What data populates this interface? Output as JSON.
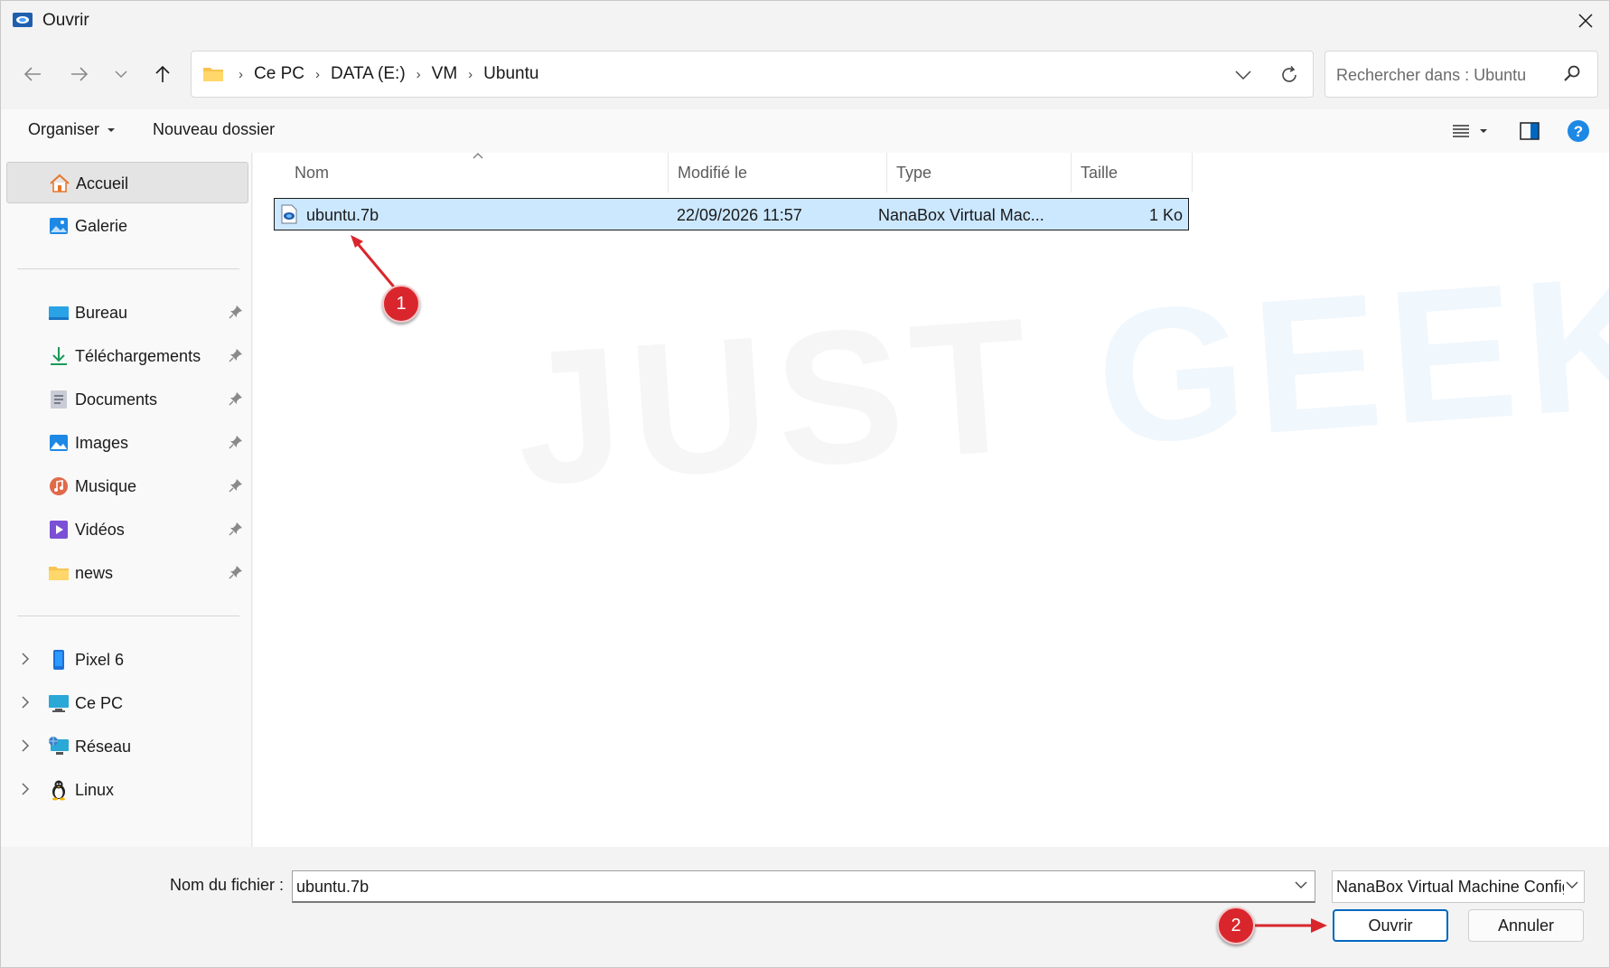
{
  "window": {
    "title": "Ouvrir"
  },
  "address": {
    "crumbs": [
      "Ce PC",
      "DATA (E:)",
      "VM",
      "Ubuntu"
    ]
  },
  "search": {
    "placeholder": "Rechercher dans : Ubuntu"
  },
  "toolbar": {
    "organize_label": "Organiser",
    "new_folder_label": "Nouveau dossier"
  },
  "sidebar": {
    "top_items": [
      {
        "label": "Accueil",
        "icon": "home-icon",
        "selected": true
      },
      {
        "label": "Galerie",
        "icon": "gallery-icon"
      }
    ],
    "pinned_items": [
      {
        "label": "Bureau",
        "icon": "desktop-icon"
      },
      {
        "label": "Téléchargements",
        "icon": "download-icon"
      },
      {
        "label": "Documents",
        "icon": "documents-icon"
      },
      {
        "label": "Images",
        "icon": "pictures-icon"
      },
      {
        "label": "Musique",
        "icon": "music-icon"
      },
      {
        "label": "Vidéos",
        "icon": "videos-icon"
      },
      {
        "label": "news",
        "icon": "folder-icon"
      }
    ],
    "device_items": [
      {
        "label": "Pixel 6",
        "icon": "phone-icon"
      },
      {
        "label": "Ce PC",
        "icon": "computer-icon"
      },
      {
        "label": "Réseau",
        "icon": "network-icon"
      },
      {
        "label": "Linux",
        "icon": "linux-penguin-icon"
      }
    ]
  },
  "columns": {
    "name": "Nom",
    "modified": "Modifié le",
    "type": "Type",
    "size": "Taille"
  },
  "files": [
    {
      "name": "ubuntu.7b",
      "modified": "22/09/2026 11:57",
      "type": "NanaBox Virtual Mac...",
      "size": "1 Ko",
      "selected": true
    }
  ],
  "watermark": {
    "text_1": "JUST",
    "text_2": "GEEK"
  },
  "annotations": {
    "first": "1",
    "second": "2"
  },
  "footer": {
    "filename_label": "Nom du fichier :",
    "filename_value": "ubuntu.7b",
    "filetype_value": "NanaBox Virtual Machine Configuration",
    "open_label": "Ouvrir",
    "cancel_label": "Annuler"
  },
  "colors": {
    "accent": "#0067c0",
    "selection": "#cce8ff",
    "annotation": "#d9262d",
    "folder": "#f8c44f"
  }
}
